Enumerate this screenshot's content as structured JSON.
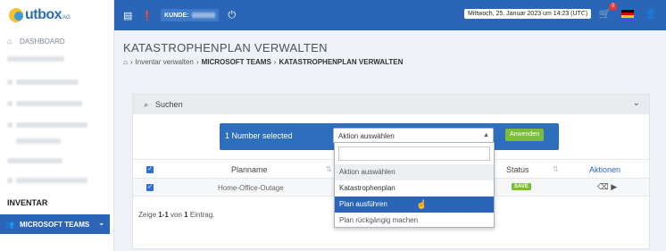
{
  "sidebar": {
    "dashboard": "DASHBOARD",
    "section_inventar": "INVENTAR",
    "active_item": "MICROSOFT TEAMS"
  },
  "topbar": {
    "kunde_label": "KUNDE:",
    "datetime": "Mittwoch, 25. Januar 2023 um 14:23 (UTC)",
    "cart_count": "0"
  },
  "page": {
    "title": "KATASTROPHENPLAN VERWALTEN",
    "breadcrumb": [
      "Inventar verwalten",
      "MICROSOFT TEAMS",
      "KATASTROPHENPLAN VERWALTEN"
    ]
  },
  "search": {
    "label": "Suchen"
  },
  "action_bar": {
    "selected_label": "1 Number selected",
    "select_value": "Aktion auswählen",
    "apply_label": "Anwenden"
  },
  "table": {
    "headers": {
      "planname": "Planname",
      "status": "Status",
      "aktionen": "Aktionen"
    },
    "rows": [
      {
        "planname": "Home-Office-Outage",
        "status": "SAVE"
      }
    ],
    "footer_prefix": "Zeige ",
    "footer_range": "1-1",
    "footer_mid": " von ",
    "footer_total": "1",
    "footer_suffix": " Eintrag."
  },
  "dropdown": {
    "options": [
      "Aktion auswählen",
      "Katastrophenplan",
      "Plan ausführen",
      "Plan rückgängig machen"
    ]
  },
  "colors": {
    "primary": "#2b65b8",
    "accent_green": "#7dbb3c",
    "badge_red": "#e53935"
  }
}
